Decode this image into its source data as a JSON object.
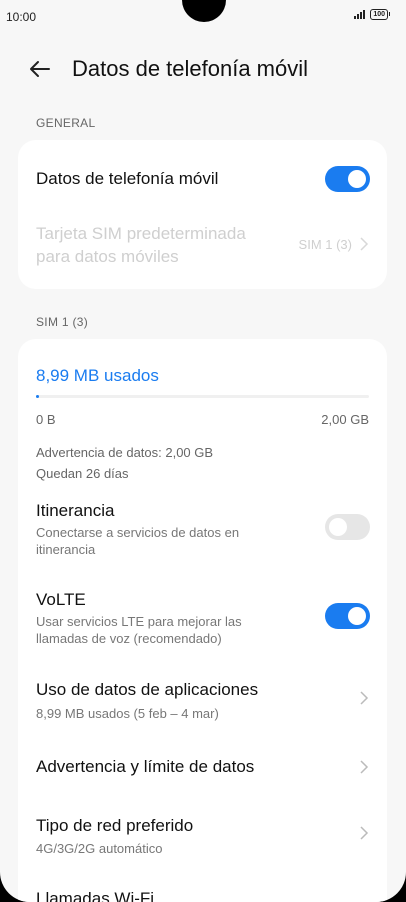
{
  "status": {
    "time": "10:00",
    "battery": "100"
  },
  "header": {
    "title": "Datos de telefonía móvil"
  },
  "general": {
    "section_label": "GENERAL",
    "mobile_data": {
      "label": "Datos de telefonía móvil",
      "enabled": true
    },
    "default_sim": {
      "label_line1": "Tarjeta SIM predeterminada",
      "label_line2": "para datos móviles",
      "value": "SIM 1 (3)"
    }
  },
  "sim": {
    "section_label": "SIM 1 (3)",
    "usage_label": "8,99 MB usados",
    "usage_fraction": 0.0044,
    "bar_min": "0 B",
    "bar_max": "2,00 GB",
    "warning": "Advertencia de datos: 2,00 GB",
    "days_left": "Quedan 26 días",
    "roaming": {
      "title": "Itinerancia",
      "sub_line1": "Conectarse a servicios de datos en",
      "sub_line2": "itinerancia",
      "enabled": false
    },
    "volte": {
      "title": "VoLTE",
      "sub_line1": "Usar servicios LTE para mejorar las",
      "sub_line2": "llamadas de voz (recomendado)",
      "enabled": true
    },
    "app_usage": {
      "title": "Uso de datos de aplicaciones",
      "sub": "8,99 MB usados (5 feb – 4 mar)"
    },
    "limit": {
      "title": "Advertencia y límite de datos"
    },
    "network_type": {
      "title": "Tipo de red preferido",
      "sub": "4G/3G/2G automático"
    },
    "wifi_calls": {
      "title": "Llamadas Wi-Fi"
    }
  },
  "colors": {
    "accent": "#1a7cf0",
    "toggle_off": "#e6e6e6",
    "background": "#f7f7f7"
  }
}
